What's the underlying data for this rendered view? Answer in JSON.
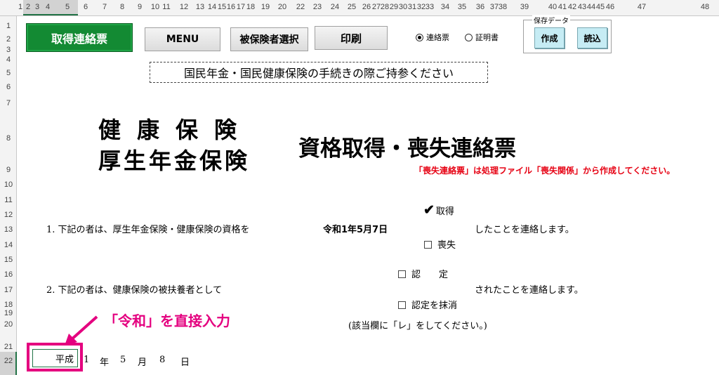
{
  "column_headers": [
    "1",
    "2",
    "3",
    "4",
    "5",
    "6",
    "7",
    "8",
    "9",
    "10",
    "11",
    "12",
    "13",
    "14",
    "15",
    "16",
    "17",
    "18",
    "19",
    "20",
    "21",
    "22",
    "23",
    "24",
    "25",
    "26",
    "27",
    "28",
    "29",
    "30",
    "31",
    "32",
    "33",
    "34",
    "35",
    "36",
    "37",
    "38",
    "39",
    "40",
    "41",
    "42",
    "43",
    "44",
    "45",
    "46",
    "47",
    "48"
  ],
  "row_headers": [
    "1",
    "2",
    "3",
    "4",
    "5",
    "6",
    "7",
    "8",
    "9",
    "10",
    "11",
    "12",
    "13",
    "14",
    "15",
    "16",
    "17",
    "18",
    "19",
    "20",
    "21",
    "22"
  ],
  "toolbar": {
    "primary_button": "取得連絡票",
    "menu_button": "MENU",
    "insured_select_button": "被保険者選択",
    "print_button": "印刷",
    "radio_renraku": "連絡票",
    "radio_shomei": "証明書",
    "save_group_title": "保存データ",
    "create_button": "作成",
    "load_button": "読込"
  },
  "form": {
    "notice": "国民年金・国民健康保険の手続きの際ご持参ください",
    "title_line1": "健康保険",
    "title_line2": "厚生年金保険",
    "subtitle": "資格取得・喪失連絡票",
    "red_note": "「喪失連絡票」は処理ファイル「喪失関係」から作成してください。",
    "item1_text": "1. 下記の者は、厚生年金保険・健康保険の資格を",
    "item1_date": "令和1年5月7日",
    "option_acquire": "取得",
    "option_loss": "喪失",
    "item1_suffix": "したことを連絡します。",
    "item2_text": "2. 下記の者は、健康保険の被扶養者として",
    "option_approve": "認　　定",
    "option_cancel": "認定を抹消",
    "item2_suffix": "されたことを連絡します。",
    "instruction": "(該当欄に「レ」をしてください。)",
    "annotation": "「令和」を直接入力",
    "era_value": "平成",
    "date_year": "1",
    "year_unit": "年",
    "date_month": "5",
    "month_unit": "月",
    "date_day": "8",
    "day_unit": "日"
  },
  "colors": {
    "primary_button": "#138a33",
    "annotation": "#e4007f",
    "red_note": "#e60012",
    "cyan_button": "#c6ecf4"
  },
  "icons": [
    "checkmark-icon",
    "checkbox-icon",
    "radio-icon",
    "pointer-arrow-icon"
  ]
}
